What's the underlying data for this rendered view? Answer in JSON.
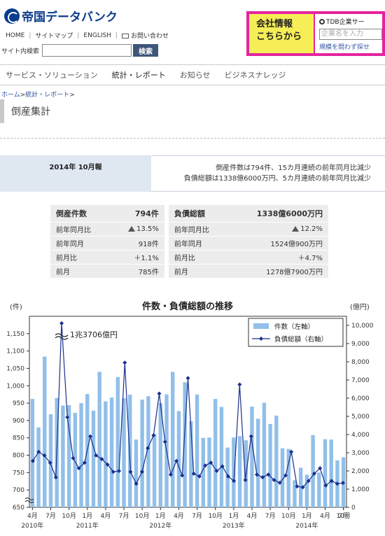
{
  "header": {
    "logo_text": "帝国データバンク",
    "nav": [
      "HOME",
      "サイトマップ",
      "ENGLISH",
      "お問い合わせ"
    ],
    "search_label": "サイト内検索",
    "search_button": "検索"
  },
  "promo": {
    "line1": "会社情報",
    "line2": "こちらから",
    "service_label": "TDB企業サー",
    "search_placeholder": "企業名を入力",
    "note": "規模を問わず探せ"
  },
  "mainnav": [
    "サービス・ソリューション",
    "統計・レポート",
    "お知らせ",
    "ビジネスナレッジ"
  ],
  "breadcrumb": {
    "home": "ホーム",
    "sep": ">",
    "current": "統計・レポート"
  },
  "page_title": "倒産集計",
  "report": {
    "period": "2014年 10月報",
    "line1": "倒産件数は794件、15カ月連続の前年同月比減少",
    "line2": "負債総額は1338億6000万円、5カ月連続の前年同月比減少"
  },
  "stats": {
    "left_title": "倒産件数",
    "left_value": "794件",
    "right_title": "負債総額",
    "right_value": "1338億6000万円",
    "rows": [
      {
        "label": "前年同月比",
        "left": "13.5%",
        "right_label": "前年同月比",
        "right": "12.2%",
        "arrow": true
      },
      {
        "label": "前年同月",
        "left": "918件",
        "right_label": "前年同月",
        "right": "1524億900万円",
        "arrow": false
      },
      {
        "label": "前月比",
        "left": "＋1.1%",
        "right_label": "前月比",
        "right": "＋4.7%",
        "arrow": false
      },
      {
        "label": "前月",
        "left": "785件",
        "right_label": "前月",
        "right": "1278億7900万円",
        "arrow": false
      }
    ]
  },
  "colors": {
    "bar": "#91bfe9",
    "line": "#1a2f8c",
    "promo_bg": "#e4249e",
    "promo_left": "#f6ee57",
    "nav_button": "#3e5678"
  },
  "chart_data": {
    "type": "bar",
    "title": "件数・負債総額の推移",
    "left_unit": "(件)",
    "right_unit": "(億円)",
    "annotation": "1兆3706億円",
    "ylim_left": [
      650,
      1200
    ],
    "yticks_left": [
      650,
      700,
      750,
      800,
      850,
      900,
      950,
      1000,
      1050,
      1100,
      1150
    ],
    "ytick_labels_left": [
      "650",
      "700",
      "750",
      "800",
      "850",
      "900",
      "950",
      "1,000",
      "1,050",
      "1,100",
      "1,150"
    ],
    "ylim_right": [
      0,
      10500
    ],
    "yticks_right": [
      0,
      1000,
      2000,
      3000,
      4000,
      5000,
      6000,
      7000,
      8000,
      9000,
      10000
    ],
    "ytick_labels_right": [
      "0",
      "1,000",
      "2,000",
      "3,000",
      "4,000",
      "5,000",
      "6,000",
      "7,000",
      "8,000",
      "9,000",
      "10,000"
    ],
    "x_month_labels": [
      "4月",
      "7月",
      "10月",
      "1月",
      "4月",
      "7月",
      "10月",
      "1月",
      "4月",
      "7月",
      "10月",
      "1月",
      "4月",
      "7月",
      "10月",
      "1月",
      "4月",
      "7月",
      "10月"
    ],
    "x_year_labels": [
      "2010年",
      "2011年",
      "2012年",
      "2013年",
      "2014年"
    ],
    "series": [
      {
        "name": "件数（左軸）",
        "axis": "left",
        "values": [
          962,
          880,
          1084,
          918,
          965,
          943,
          944,
          922,
          950,
          976,
          928,
          1040,
          955,
          966,
          1025,
          964,
          974,
          845,
          960,
          970,
          862,
          950,
          975,
          1040,
          927,
          1010,
          898,
          975,
          850,
          851,
          962,
          939,
          822,
          851,
          855,
          843,
          940,
          905,
          951,
          890,
          914,
          820,
          818,
          728,
          764,
          744,
          858,
          750,
          846,
          845,
          785,
          794
        ]
      },
      {
        "name": "負債総額（右軸）",
        "axis": "right",
        "values": [
          2550,
          3050,
          2850,
          2450,
          1650,
          13706,
          4950,
          2700,
          2150,
          2450,
          3900,
          2850,
          2650,
          2350,
          1950,
          2000,
          7950,
          1950,
          1300,
          1950,
          3250,
          3950,
          6250,
          3600,
          1800,
          2550,
          1750,
          7100,
          1850,
          1700,
          2300,
          2450,
          2000,
          2250,
          1700,
          1450,
          6750,
          1500,
          3900,
          1800,
          1650,
          1800,
          1500,
          1350,
          1750,
          3050,
          1150,
          1100,
          1450,
          1850,
          2150,
          1200,
          1450,
          1300,
          1340
        ]
      }
    ]
  }
}
